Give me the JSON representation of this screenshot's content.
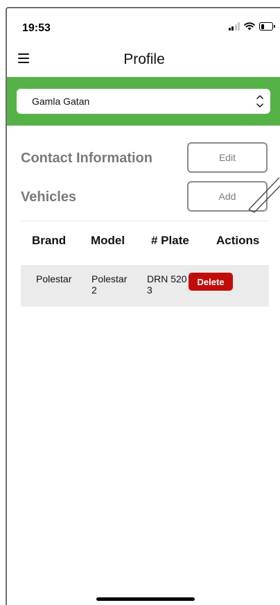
{
  "status_bar": {
    "time": "19:53",
    "icons": [
      "signal-icon",
      "wifi-icon",
      "battery-icon"
    ]
  },
  "nav": {
    "menu_icon": "hamburger-menu-icon",
    "title": "Profile"
  },
  "location_select": {
    "value": "Gamla Gatan",
    "icon": "chevron-up-down-icon"
  },
  "contact": {
    "heading": "Contact Information",
    "edit_label": "Edit"
  },
  "vehicles": {
    "heading": "Vehicles",
    "add_label": "Add",
    "columns": [
      "Brand",
      "Model",
      "# Plate",
      "Actions"
    ],
    "rows": [
      {
        "brand": "Polestar",
        "model": "Polestar 2",
        "plate": "DRN 5203",
        "action_label": "Delete"
      }
    ]
  },
  "colors": {
    "header_band": "#55b246",
    "delete": "#c20c0c",
    "muted_text": "#7a7a7a",
    "row_background": "#ebebeb"
  }
}
